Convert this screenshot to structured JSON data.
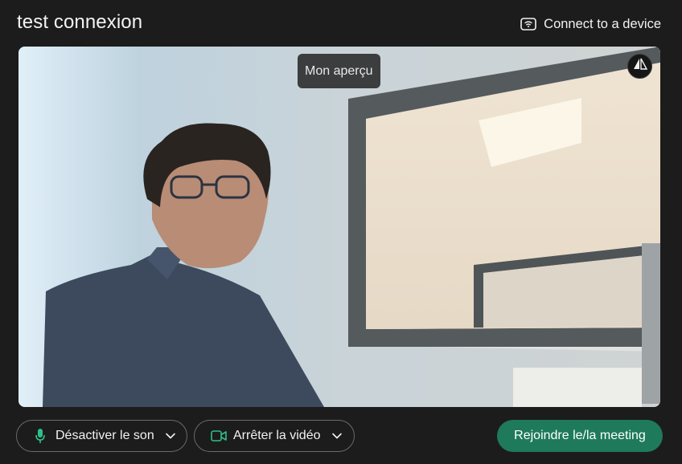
{
  "header": {
    "title": "test connexion",
    "connect_device_label": "Connect to a device"
  },
  "preview": {
    "label": "Mon aperçu",
    "mirror_icon": "mirror-flip-icon"
  },
  "controls": {
    "mic": {
      "label": "Désactiver le son",
      "icon": "microphone-icon"
    },
    "camera": {
      "label": "Arrêter la vidéo",
      "icon": "video-camera-icon"
    },
    "join_label": "Rejoindre le/la meeting"
  },
  "colors": {
    "background": "#1c1c1c",
    "accent_green": "#1e7a5a",
    "icon_green": "#2fc08a"
  }
}
